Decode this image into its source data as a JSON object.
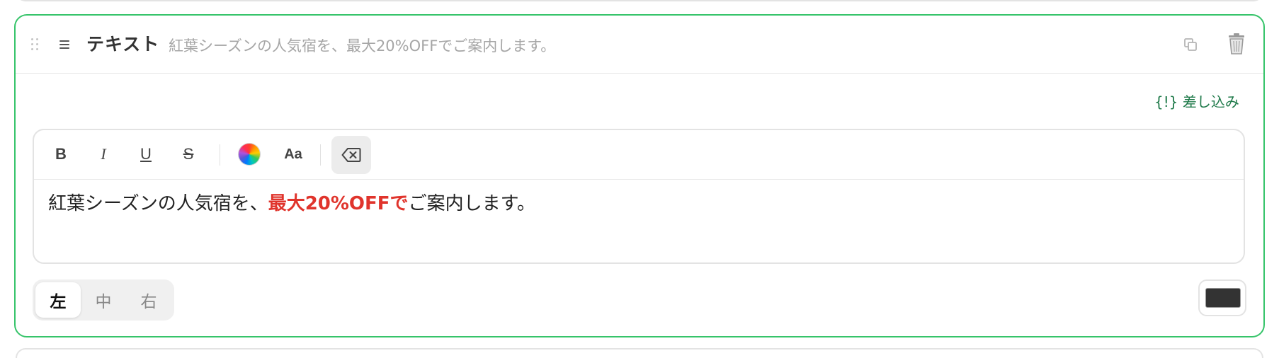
{
  "block": {
    "type_label": "テキスト",
    "preview_text": "紅葉シーズンの人気宿を、最大20%OFFでご案内します。"
  },
  "merge_tag": {
    "label": "{!} 差し込み"
  },
  "toolbar": {
    "bold": "B",
    "italic": "I",
    "underline": "U",
    "strike": "S",
    "font_size": "Aa"
  },
  "editor": {
    "segments": [
      {
        "text": "紅葉シーズンの人気宿を、",
        "style": "normal"
      },
      {
        "text": "最大20%OFFで",
        "style": "highlight",
        "color": "#e0342c"
      },
      {
        "text": "ご案内します。",
        "style": "normal"
      }
    ]
  },
  "alignment": {
    "options": [
      "左",
      "中",
      "右"
    ],
    "selected": "左"
  },
  "text_color": {
    "value": "#333333"
  },
  "colors": {
    "accent_border": "#36c46a",
    "merge_link": "#1f7a4a",
    "highlight_red": "#e0342c"
  }
}
